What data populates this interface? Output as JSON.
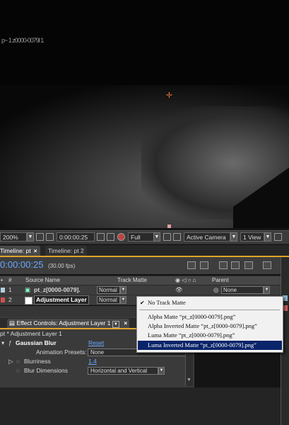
{
  "viewer": {
    "overlay_text": "p~ 1 z0000-0079l 1",
    "crosshair": "anchor-point-icon"
  },
  "viewer_toolbar": {
    "zoom": "200%",
    "timecode": "0:00:00:25",
    "resolution": "Full",
    "camera": "Active Camera",
    "view": "1 View"
  },
  "timeline_tabs": [
    {
      "label": "Timeline: pt",
      "close": "×"
    },
    {
      "label": "Timeline: pt 2"
    }
  ],
  "timeline": {
    "current_time": "0:00:00:25",
    "fps": "(30.00 fps)",
    "headers": {
      "number": "#",
      "source_name": "Source Name",
      "track_matte": "Track Matte",
      "parent": "Parent"
    },
    "layers": [
      {
        "num": "1",
        "name": "pt_z[0000-0079].",
        "mode": "Normal",
        "parent": "None",
        "color": "#b4d0e0"
      },
      {
        "num": "2",
        "name": "Adjustment Layer",
        "mode": "Normal",
        "color": "#d05050"
      }
    ]
  },
  "track_matte_menu": {
    "items": [
      {
        "label": "No Track Matte",
        "checked": true
      },
      {
        "label": "Alpha Matte  “pt_z[0000-0079].png”"
      },
      {
        "label": "Alpha Inverted Matte  “pt_z[0000-0079].png”"
      },
      {
        "label": "Luma Matte  “pt_z[0000-0079].png”"
      },
      {
        "label": "Luma Inverted Matte  “pt_z[0000-0079].png”",
        "selected": true
      }
    ]
  },
  "effect_controls": {
    "tab_label": "Effect Controls: Adjustment Layer 1",
    "close": "×",
    "breadcrumb": "pt * Adjustment Layer 1",
    "effect_name": "Gaussian Blur",
    "reset_label": "Reset",
    "presets_label": "Animation Presets:",
    "presets_value": "None",
    "blurriness_label": "Blurriness",
    "blurriness_value": "1.4",
    "blur_dimensions_label": "Blur Dimensions",
    "blur_dimensions_value": "Horizontal and Vertical"
  },
  "colors": {
    "accent": "#e0a32a",
    "timecode_blue": "#6aa8ff",
    "menu_highlight": "#0a246a"
  }
}
